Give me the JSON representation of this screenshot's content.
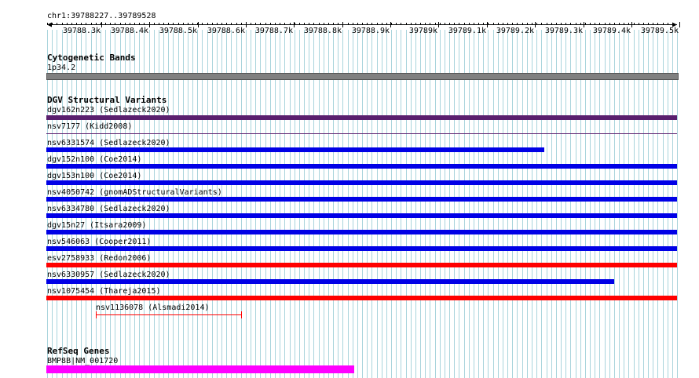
{
  "ruler": {
    "coords_label": "chr1:39788227..39789528",
    "tick_labels": [
      "39788.3k",
      "39788.4k",
      "39788.5k",
      "39788.6k",
      "39788.7k",
      "39788.8k",
      "39788.9k",
      "39789k",
      "39789.1k",
      "39789.2k",
      "39789.3k",
      "39789.4k",
      "39789.5k"
    ]
  },
  "cytoband": {
    "title": "Cytogenetic Bands",
    "band_name": "1p34.2",
    "color": "#808080"
  },
  "dgv": {
    "title": "DGV Structural Variants",
    "variants": [
      {
        "label": "dgv162n223 (Sedlazeck2020)",
        "color": "#5a1f6e"
      },
      {
        "label": "nsv7177 (Kidd2008)",
        "color": "#5a1f6e"
      },
      {
        "label": "nsv6331574 (Sedlazeck2020)",
        "color": "#0000e6"
      },
      {
        "label": "dgv152n100 (Coe2014)",
        "color": "#0000e6"
      },
      {
        "label": "dgv153n100 (Coe2014)",
        "color": "#0000e6"
      },
      {
        "label": "nsv4050742 (gnomADStructuralVariants)",
        "color": "#0000e6"
      },
      {
        "label": "nsv6334780 (Sedlazeck2020)",
        "color": "#0000e6"
      },
      {
        "label": "dgv15n27 (Itsara2009)",
        "color": "#0000e6"
      },
      {
        "label": "nsv546063 (Cooper2011)",
        "color": "#0000e6"
      },
      {
        "label": "esv2758933 (Redon2006)",
        "color": "#ff0000"
      },
      {
        "label": "nsv6330957 (Sedlazeck2020)",
        "color": "#0000e6"
      },
      {
        "label": "nsv1075454 (Thareja2015)",
        "color": "#ff0000"
      },
      {
        "label": "nsv1136078 (Alsmadi2014)",
        "color": "#ff0000"
      }
    ]
  },
  "refseq": {
    "title": "RefSeq Genes",
    "gene_label": "BMP8B|NM_001720",
    "color": "#ff00ff"
  },
  "colors": {
    "grid_line": "#a9d4dc",
    "text": "#000000"
  }
}
